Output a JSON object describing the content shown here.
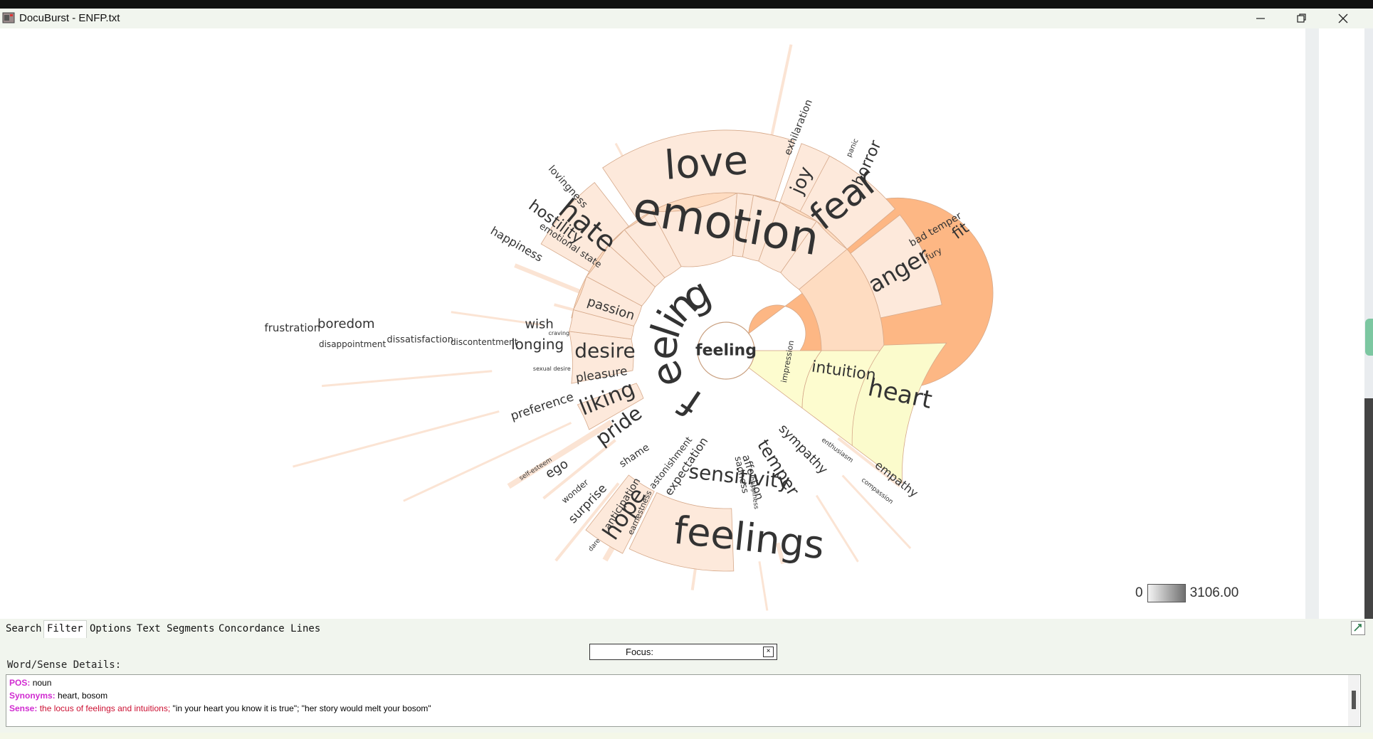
{
  "window": {
    "title": "DocuBurst - ENFP.txt"
  },
  "legend": {
    "min": "0",
    "max": "3106.00"
  },
  "tabs": [
    {
      "label": "Search",
      "active": false
    },
    {
      "label": "Filter",
      "active": true
    },
    {
      "label": "Options",
      "active": false
    },
    {
      "label": "Text Segments",
      "active": false
    },
    {
      "label": "Concordance Lines",
      "active": false
    }
  ],
  "focus": {
    "label": "Focus:",
    "clear": "×"
  },
  "details": {
    "title": "Word/Sense Details:",
    "pos_label": "POS:",
    "pos_value": "noun",
    "syn_label": "Synonyms:",
    "syn_value": "heart, bosom",
    "sense_label": "Sense:",
    "sense_def": "the locus of feelings and intuitions;",
    "sense_examples": "\"in your heart you know it is true\"; \"her story would melt your bosom\""
  },
  "sunburst": {
    "center": "feeling",
    "ring1": [
      "feeling",
      "impression"
    ],
    "ring2": [
      "emotion",
      "passion",
      "desire",
      "pleasure",
      "liking",
      "pride",
      "shame",
      "astonishment",
      "expectation",
      "sensitivity",
      "sadness",
      "affection",
      "temper",
      "sympathy",
      "intuition"
    ],
    "ring3": [
      "love",
      "joy",
      "fear",
      "anger",
      "hate",
      "hostility",
      "happiness",
      "emotional state",
      "lovingness",
      "exhilaration",
      "panic",
      "horror",
      "bad temper",
      "fury",
      "fit",
      "wish",
      "longing",
      "discontentment",
      "dissatisfaction",
      "boredom",
      "disappointment",
      "frustration",
      "preference",
      "ego",
      "self-esteem",
      "wonder",
      "surprise",
      "anticipation",
      "earnestness",
      "hope",
      "feelings",
      "empathy",
      "compassion",
      "enthusiasm",
      "heart",
      "craving",
      "sexual desire",
      "happiness",
      "dare"
    ]
  },
  "colors": {
    "center_ring": "#fdb784",
    "emotion_ring": "#fedcc1",
    "leaf": "#fde9db",
    "intuition": "#fdfccf",
    "heart": "#fbfbcc"
  }
}
